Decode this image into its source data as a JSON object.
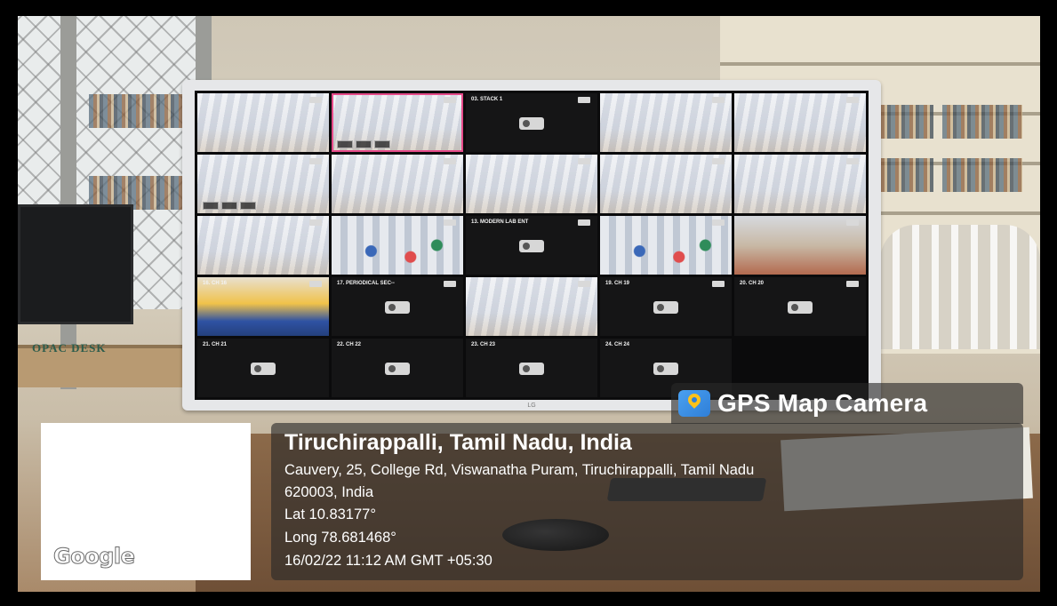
{
  "photo": {
    "scene_labels": {
      "opac_desk": "OPAC DESK"
    }
  },
  "cctv": {
    "tiles": [
      {
        "label": "",
        "type": "live"
      },
      {
        "label": "",
        "type": "live-selected"
      },
      {
        "label": "03. STACK 1",
        "type": "offline"
      },
      {
        "label": "",
        "type": "live"
      },
      {
        "label": "",
        "type": "live"
      },
      {
        "label": "",
        "type": "live"
      },
      {
        "label": "",
        "type": "live"
      },
      {
        "label": "",
        "type": "live"
      },
      {
        "label": "",
        "type": "live"
      },
      {
        "label": "",
        "type": "live"
      },
      {
        "label": "",
        "type": "live"
      },
      {
        "label": "",
        "type": "live-busy"
      },
      {
        "label": "13. MODERN LAB ENT",
        "type": "offline"
      },
      {
        "label": "",
        "type": "live-busy"
      },
      {
        "label": "",
        "type": "live-red"
      },
      {
        "label": "16. CH 16",
        "type": "live-blue"
      },
      {
        "label": "17. PERIODICAL SEC--",
        "type": "offline"
      },
      {
        "label": "",
        "type": "live"
      },
      {
        "label": "19. CH 19",
        "type": "offline"
      },
      {
        "label": "20. CH 20",
        "type": "offline"
      }
    ],
    "bottom_row": [
      {
        "label": "21. CH 21"
      },
      {
        "label": "22. CH 22"
      },
      {
        "label": "23. CH 23"
      },
      {
        "label": "24. CH 24"
      }
    ],
    "brand": "LG"
  },
  "overlay": {
    "app_name": "GPS Map Camera",
    "map_provider": "Google",
    "location_title": "Tiruchirappalli, Tamil Nadu, India",
    "address_line1": "Cauvery, 25, College Rd, Viswanatha Puram, Tiruchirappalli, Tamil Nadu",
    "address_line2": "620003, India",
    "latitude": "Lat 10.83177°",
    "longitude": "Long 78.681468°",
    "timestamp": "16/02/22 11:12 AM GMT +05:30"
  },
  "colors": {
    "selected_tile": "#e64b8a",
    "overlay_bg": "#282828",
    "gps_icon": "#2f7fd8",
    "gps_pin": "#ffc21a"
  }
}
